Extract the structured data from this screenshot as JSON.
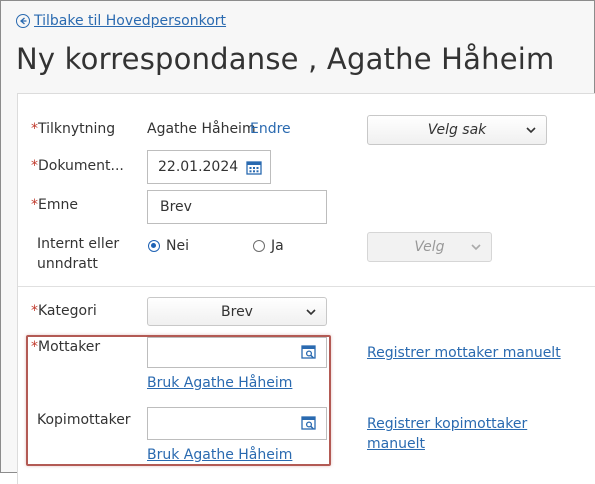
{
  "back_link": {
    "label": "Tilbake til Hovedpersonkort"
  },
  "page": {
    "title": "Ny korrespondanse , Agathe Håheim"
  },
  "form": {
    "required_marker": "*",
    "tilknytning": {
      "label": "Tilknytning",
      "value": "Agathe Håheim",
      "change_link": "Endre"
    },
    "velg_sak": {
      "label": "Velg sak"
    },
    "dokument": {
      "label": "Dokument...",
      "value": "22.01.2024"
    },
    "emne": {
      "label": "Emne",
      "value": "Brev"
    },
    "internt": {
      "label_line1": "Internt eller",
      "label_line2": "unndratt",
      "option_nei": "Nei",
      "option_ja": "Ja",
      "selected": "Nei",
      "velg_label": "Velg"
    },
    "kategori": {
      "label": "Kategori",
      "value": "Brev"
    },
    "mottaker": {
      "label": "Mottaker",
      "value": "",
      "use_link": "Bruk Agathe Håheim",
      "register_link": "Registrer mottaker manuelt"
    },
    "kopimottaker": {
      "label": "Kopimottaker",
      "value": "",
      "use_link": "Bruk Agathe Håheim",
      "register_link_line1": "Registrer kopimottaker",
      "register_link_line2": "manuelt"
    }
  },
  "colors": {
    "accent": "#2a6ab0",
    "required": "#c0392b",
    "highlight": "#b35a54"
  },
  "icons": {
    "back": "arrow-left-circle-icon",
    "calendar": "calendar-icon",
    "lookup": "address-search-icon",
    "chevron": "chevron-down-icon"
  }
}
